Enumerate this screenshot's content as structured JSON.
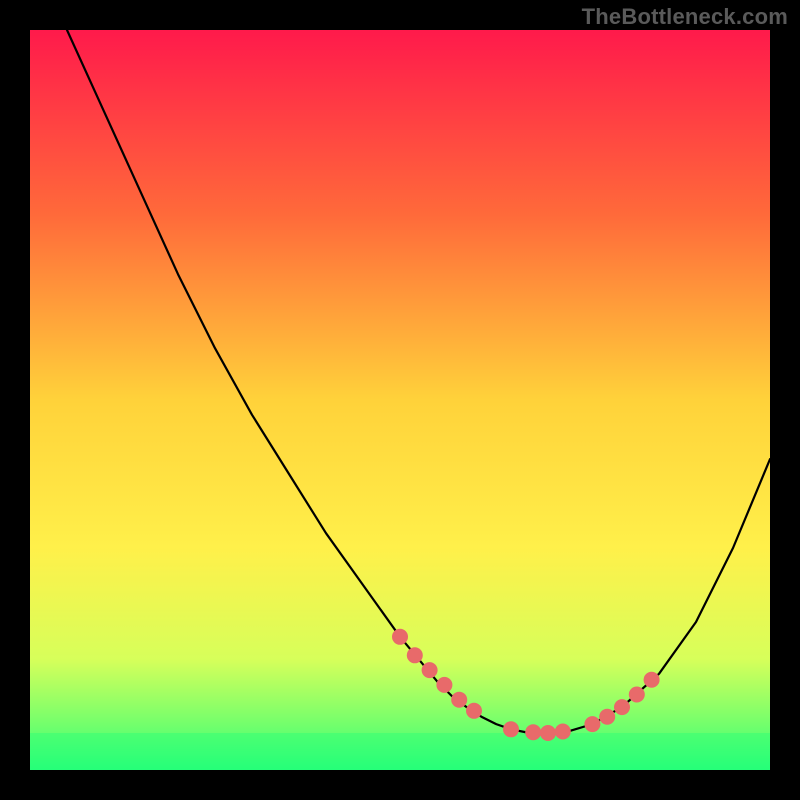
{
  "watermark": "TheBottleneck.com",
  "chart_data": {
    "type": "line",
    "title": "",
    "xlabel": "",
    "ylabel": "",
    "xlim": [
      0,
      100
    ],
    "ylim": [
      0,
      100
    ],
    "grid": false,
    "legend": false,
    "curve": {
      "x": [
        5,
        10,
        15,
        20,
        25,
        30,
        35,
        40,
        45,
        50,
        55,
        57,
        59,
        61,
        63,
        65,
        67,
        70,
        73,
        76,
        80,
        85,
        90,
        95,
        100
      ],
      "y": [
        100,
        89,
        78,
        67,
        57,
        48,
        40,
        32,
        25,
        18,
        12,
        10,
        8.5,
        7.2,
        6.2,
        5.5,
        5.1,
        5.0,
        5.3,
        6.2,
        8.5,
        13,
        20,
        30,
        42
      ]
    },
    "markers": {
      "x": [
        50,
        52,
        54,
        56,
        58,
        60,
        65,
        68,
        70,
        72,
        76,
        78,
        80,
        82,
        84
      ],
      "y": [
        18,
        15.5,
        13.5,
        11.5,
        9.5,
        8,
        5.5,
        5.1,
        5.0,
        5.2,
        6.2,
        7.2,
        8.5,
        10.2,
        12.2
      ]
    },
    "green_band": {
      "y_top": 5.0,
      "y_bottom": 0.0
    },
    "gradient_stops": [
      {
        "offset": 0.0,
        "color": "#ff1a4b"
      },
      {
        "offset": 0.25,
        "color": "#ff6a3a"
      },
      {
        "offset": 0.5,
        "color": "#ffd23a"
      },
      {
        "offset": 0.7,
        "color": "#fff04a"
      },
      {
        "offset": 0.85,
        "color": "#d7ff5a"
      },
      {
        "offset": 0.93,
        "color": "#7dff6a"
      },
      {
        "offset": 1.0,
        "color": "#2bff7a"
      }
    ]
  }
}
